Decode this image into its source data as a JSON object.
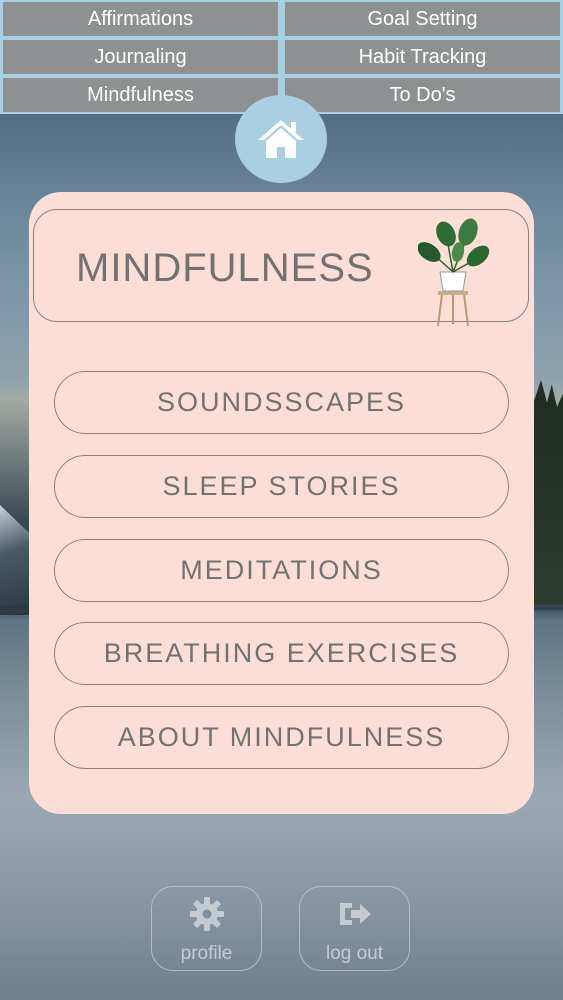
{
  "nav": {
    "items": [
      {
        "label": "Affirmations"
      },
      {
        "label": "Goal Setting"
      },
      {
        "label": "Journaling"
      },
      {
        "label": "Habit Tracking"
      },
      {
        "label": "Mindfulness"
      },
      {
        "label": "To Do's"
      }
    ],
    "home_icon": "home-icon"
  },
  "card": {
    "title": "MINDFULNESS",
    "illustration": "potted-plant-icon",
    "buttons": [
      {
        "label": "SOUNDSSCAPES"
      },
      {
        "label": "SLEEP STORIES"
      },
      {
        "label": "MEDITATIONS"
      },
      {
        "label": "BREATHING EXERCISES"
      },
      {
        "label": "ABOUT MINDFULNESS"
      }
    ]
  },
  "bottom": {
    "profile": {
      "label": "profile",
      "icon": "gear-icon"
    },
    "logout": {
      "label": "log out",
      "icon": "logout-icon"
    }
  },
  "colors": {
    "nav_bg": "#a9cfe0",
    "nav_button": "#8e9192",
    "card_bg": "#fbdfd7",
    "text": "#757171"
  }
}
